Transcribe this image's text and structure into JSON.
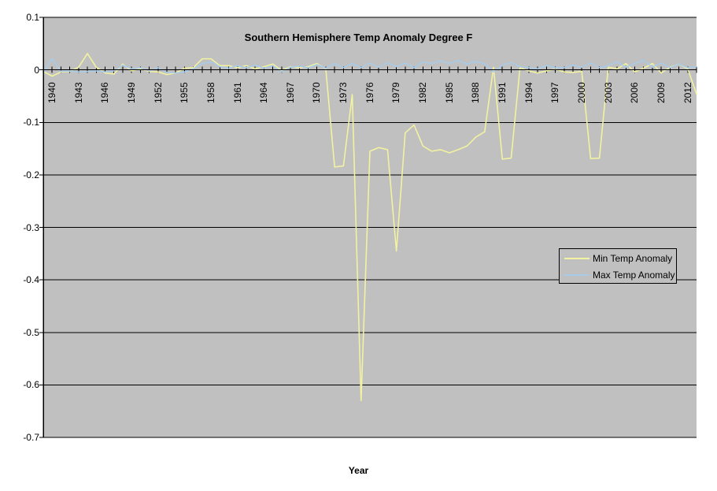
{
  "chart_data": {
    "type": "line",
    "title": "Southern Hemisphere Temp Anomaly Degree F",
    "xlabel": "Year",
    "ylabel": "",
    "xlim": [
      1940,
      2014
    ],
    "ylim": [
      -0.7,
      0.1
    ],
    "grid": true,
    "legend_position": "center-right",
    "y_ticks": [
      "0.1",
      "0",
      "-0.1",
      "-0.2",
      "-0.3",
      "-0.4",
      "-0.5",
      "-0.6",
      "-0.7"
    ],
    "y_tick_values": [
      0.1,
      0,
      -0.1,
      -0.2,
      -0.3,
      -0.4,
      -0.5,
      -0.6,
      -0.7
    ],
    "x_tick_labels": [
      "1940",
      "1943",
      "1946",
      "1949",
      "1952",
      "1955",
      "1958",
      "1961",
      "1964",
      "1967",
      "1970",
      "1973",
      "1976",
      "1979",
      "1982",
      "1985",
      "1988",
      "1991",
      "1994",
      "1997",
      "2000",
      "2003",
      "2006",
      "2009",
      "2012"
    ],
    "x": [
      1940,
      1941,
      1942,
      1943,
      1944,
      1945,
      1946,
      1947,
      1948,
      1949,
      1950,
      1951,
      1952,
      1953,
      1954,
      1955,
      1956,
      1957,
      1958,
      1959,
      1960,
      1961,
      1962,
      1963,
      1964,
      1965,
      1966,
      1967,
      1968,
      1969,
      1970,
      1971,
      1972,
      1973,
      1974,
      1975,
      1976,
      1977,
      1978,
      1979,
      1980,
      1981,
      1982,
      1983,
      1984,
      1985,
      1986,
      1987,
      1988,
      1989,
      1990,
      1991,
      1992,
      1993,
      1994,
      1995,
      1996,
      1997,
      1998,
      1999,
      2000,
      2001,
      2002,
      2003,
      2004,
      2005,
      2006,
      2007,
      2008,
      2009,
      2010,
      2011,
      2012,
      2013,
      2014
    ],
    "series": [
      {
        "name": "Min Temp Anomaly",
        "color": "#f2f2a0",
        "values": [
          -0.003,
          -0.012,
          -0.004,
          -0.003,
          0.005,
          0.031,
          0.005,
          -0.006,
          -0.008,
          0.011,
          -0.002,
          0.002,
          -0.003,
          -0.004,
          -0.009,
          -0.006,
          0.003,
          0.004,
          0.021,
          0.021,
          0.008,
          0.008,
          0.004,
          0.008,
          0.002,
          0.006,
          0.011,
          -0.001,
          0.006,
          0.004,
          0.006,
          0.012,
          0.002,
          -0.185,
          -0.183,
          -0.047,
          -0.63,
          -0.155,
          -0.148,
          -0.152,
          -0.345,
          -0.12,
          -0.105,
          -0.145,
          -0.155,
          -0.152,
          -0.158,
          -0.152,
          -0.145,
          -0.128,
          -0.118,
          0.005,
          -0.17,
          -0.168,
          0.004,
          -0.002,
          -0.006,
          -0.002,
          0.001,
          -0.004,
          -0.005,
          -0.003,
          -0.169,
          -0.168,
          0.005,
          0.002,
          0.012,
          -0.004,
          0.003,
          0.012,
          -0.006,
          0.005,
          0.011,
          0.002,
          -0.046
        ]
      },
      {
        "name": "Max Temp Anomaly",
        "color": "#a8cbe8",
        "values": [
          -0.006,
          0.021,
          -0.003,
          -0.002,
          -0.004,
          -0.003,
          -0.002,
          -0.004,
          -0.002,
          0.009,
          0.002,
          0.004,
          -0.002,
          0.004,
          -0.005,
          -0.006,
          -0.004,
          0.002,
          0.012,
          0.015,
          0.006,
          0.003,
          0.008,
          0.004,
          0.009,
          0.003,
          0.008,
          -0.004,
          0.005,
          0.007,
          0.004,
          0.01,
          0.003,
          0.012,
          0.004,
          0.012,
          0.004,
          0.013,
          0.005,
          0.014,
          0.006,
          0.013,
          0.004,
          0.015,
          0.012,
          0.017,
          0.012,
          0.018,
          0.011,
          0.016,
          0.012,
          -0.004,
          0.009,
          0.014,
          0.006,
          0.004,
          0.002,
          0.008,
          0.004,
          0.004,
          0.009,
          0.005,
          0.013,
          0.004,
          0.008,
          0.015,
          0.005,
          0.012,
          0.018,
          0.005,
          0.013,
          0.004,
          0.011,
          0.004,
          0.006
        ]
      }
    ]
  },
  "legend": {
    "entries": [
      {
        "label": "Min Temp Anomaly",
        "color": "#f2f2a0"
      },
      {
        "label": "Max Temp Anomaly",
        "color": "#a8cbe8"
      }
    ]
  },
  "colors": {
    "plot_background": "#c0c0c0",
    "axis": "#000000",
    "gridline": "#000000",
    "page_background": "#ffffff"
  }
}
